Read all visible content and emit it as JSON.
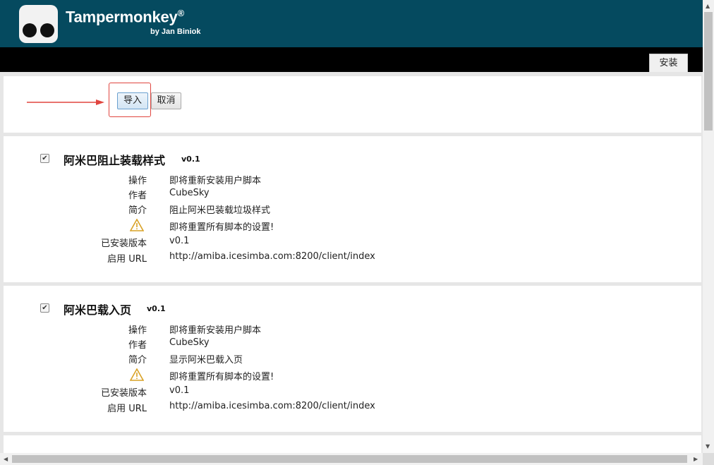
{
  "header": {
    "title": "Tampermonkey",
    "reg_mark": "®",
    "subtitle": "by Jan Biniok"
  },
  "tabs": {
    "install": "安装"
  },
  "actions": {
    "import": "导入",
    "cancel": "取消"
  },
  "colors": {
    "header_bg": "#054a5f",
    "highlight": "#e0453f",
    "warning": "#d9a227"
  },
  "labels": {
    "operation": "操作",
    "author": "作者",
    "description": "简介",
    "installed_version": "已安装版本",
    "enabled_url": "启用 URL"
  },
  "scripts": [
    {
      "name": "阿米巴阻止装载样式",
      "version": "v0.1",
      "checked": true,
      "operation": "即将重新安装用户脚本",
      "author": "CubeSky",
      "description": "阻止阿米巴装载垃圾样式",
      "warning": "即将重置所有脚本的设置!",
      "installed_version": "v0.1",
      "enabled_url": "http://amiba.icesimba.com:8200/client/index"
    },
    {
      "name": "阿米巴载入页",
      "version": "v0.1",
      "checked": true,
      "operation": "即将重新安装用户脚本",
      "author": "CubeSky",
      "description": "显示阿米巴载入页",
      "warning": "即将重置所有脚本的设置!",
      "installed_version": "v0.1",
      "enabled_url": "http://amiba.icesimba.com:8200/client/index"
    }
  ],
  "icons": {
    "logo": "tampermonkey-logo-icon",
    "warning": "warning-triangle-icon",
    "arrow": "annotation-arrow-icon"
  }
}
